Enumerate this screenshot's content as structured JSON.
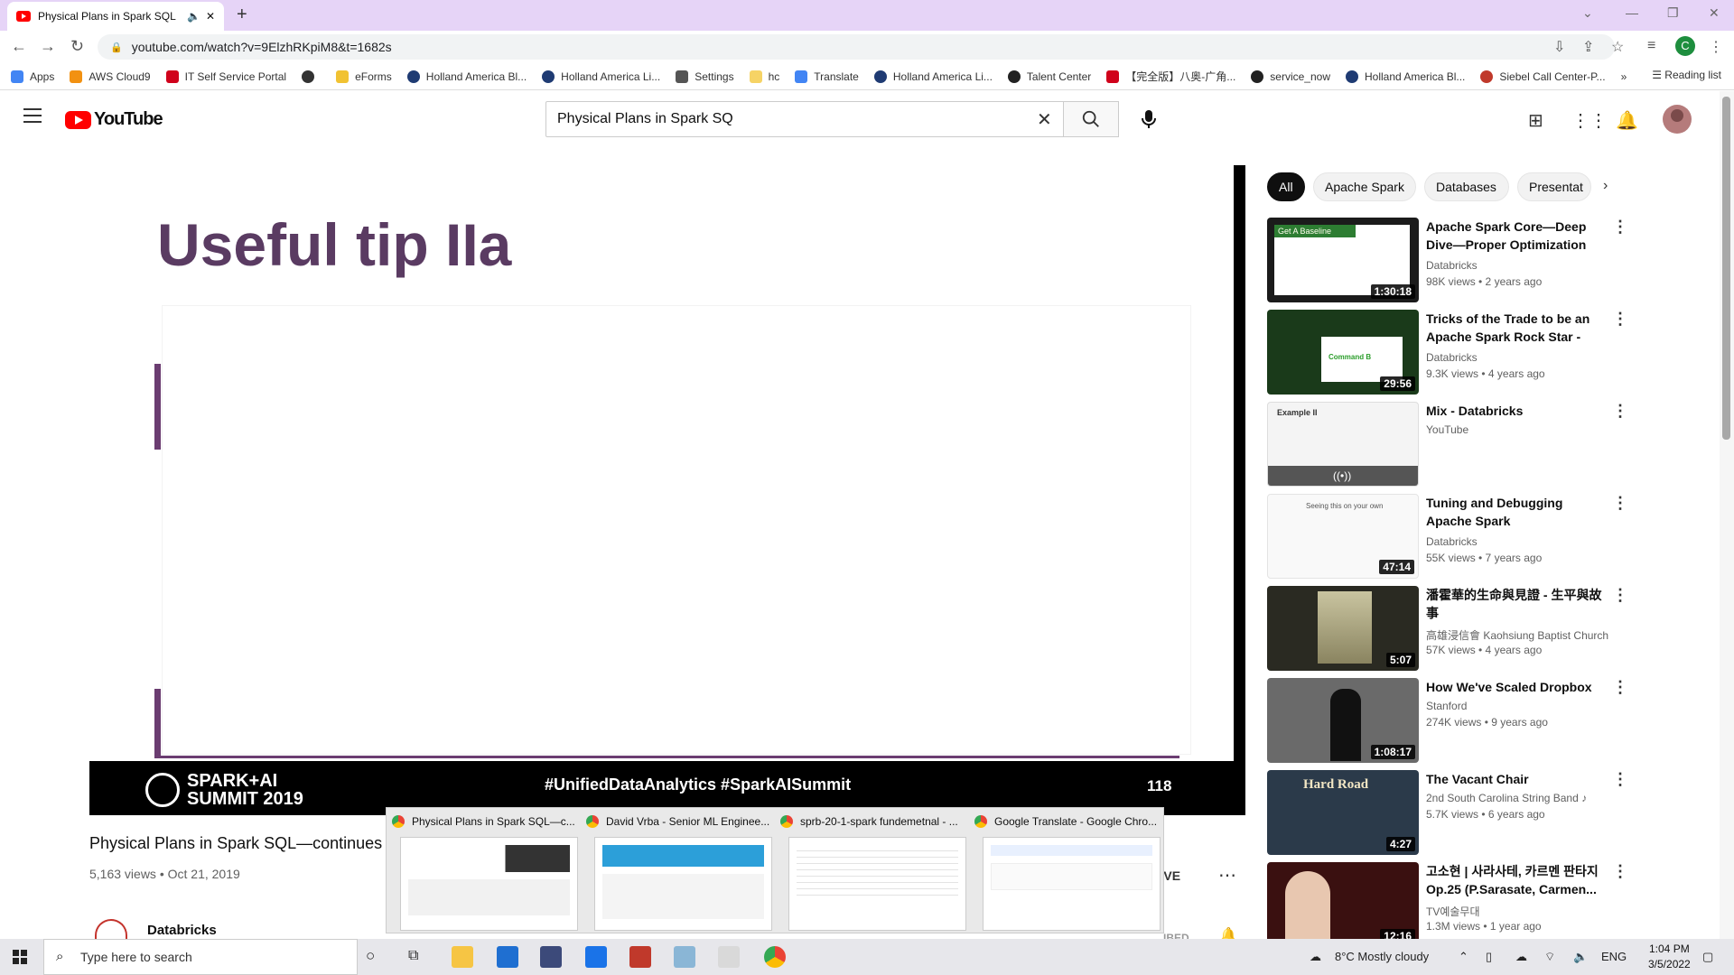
{
  "browser": {
    "tab_title": "Physical Plans in Spark SQL",
    "url": "youtube.com/watch?v=9ElzhRKpiM8&t=1682s",
    "profile_initial": "C",
    "bookmarks": [
      {
        "label": "Apps",
        "color": "#4285f4"
      },
      {
        "label": "AWS Cloud9",
        "color": "#f29111"
      },
      {
        "label": "IT Self Service Portal",
        "color": "#d0021b"
      },
      {
        "label": "",
        "color": "#333333"
      },
      {
        "label": "eForms",
        "color": "#f1c232"
      },
      {
        "label": "Holland America Bl...",
        "color": "#1f3b73"
      },
      {
        "label": "Holland America Li...",
        "color": "#1f3b73"
      },
      {
        "label": "Settings",
        "color": "#555555"
      },
      {
        "label": "hc",
        "color": "#f6d365"
      },
      {
        "label": "Translate",
        "color": "#4285f4"
      },
      {
        "label": "Holland America Li...",
        "color": "#1f3b73"
      },
      {
        "label": "Talent Center",
        "color": "#222222"
      },
      {
        "label": "【完全版】八奥-广角...",
        "color": "#d0021b"
      },
      {
        "label": "service_now",
        "color": "#222222"
      },
      {
        "label": "Holland America Bl...",
        "color": "#1f3b73"
      },
      {
        "label": "Siebel Call Center-P...",
        "color": "#c0392b"
      }
    ],
    "bookmarks_overflow": "»",
    "reading_list": "Reading list"
  },
  "youtube": {
    "logo_text": "YouTube",
    "search_value": "Physical Plans in Spark SQ",
    "player": {
      "slide_title": "Useful tip IIa",
      "footer_logo_line1": "SPARK+AI",
      "footer_logo_line2": "SUMMIT 2019",
      "hashtags": "#UnifiedDataAnalytics #SparkAISummit",
      "slide_number": "118"
    },
    "video": {
      "title": "Physical Plans in Spark SQL—continues -",
      "meta": "5,163 views • Oct 21, 2019",
      "save_label": "SAVE",
      "channel": "Databricks",
      "subscribe_peek": "IBED"
    },
    "chips": [
      "All",
      "Apache Spark",
      "Databases",
      "Presentat"
    ],
    "recommendations": [
      {
        "title": "Apache Spark Core—Deep Dive—Proper Optimization Daniel...",
        "channel": "Databricks",
        "meta": "98K views • 2 years ago",
        "duration": "1:30:18",
        "thumb_color": "#1b1b1b"
      },
      {
        "title": "Tricks of the Trade to be an Apache Spark Rock Star - Ted...",
        "channel": "Databricks",
        "meta": "9.3K views • 4 years ago",
        "duration": "29:56",
        "thumb_color": "#1a3a1a"
      },
      {
        "title": "Mix - Databricks",
        "channel": "YouTube",
        "meta": "",
        "duration": "",
        "thumb_color": "#f4f4f4"
      },
      {
        "title": "Tuning and Debugging Apache Spark",
        "channel": "Databricks",
        "meta": "55K views • 7 years ago",
        "duration": "47:14",
        "thumb_color": "#f9f9f9"
      },
      {
        "title": "潘霍華的生命與見證 - 生平與故事",
        "channel": "高雄浸信會 Kaohsiung Baptist Church",
        "meta": "57K views • 4 years ago",
        "duration": "5:07",
        "thumb_color": "#2a2a22"
      },
      {
        "title": "How We've Scaled Dropbox",
        "channel": "Stanford",
        "meta": "274K views • 9 years ago",
        "duration": "1:08:17",
        "thumb_color": "#6a6a6a"
      },
      {
        "title": "The Vacant Chair",
        "channel": "2nd South Carolina String Band ♪",
        "meta": "5.7K views • 6 years ago",
        "duration": "4:27",
        "thumb_color": "#2b3a4a"
      },
      {
        "title": "고소현 | 사라사테, 카르멘 판타지 Op.25 (P.Sarasate, Carmen...",
        "channel": "TV예술무대",
        "meta": "1.3M views • 1 year ago",
        "duration": "12:16",
        "thumb_color": "#3a1010"
      }
    ],
    "thumb_texts": {
      "baseline": "Get A Baseline",
      "command": "Command B",
      "example": "Example II",
      "seeing": "Seeing this on your own",
      "hardroad": "Hard Road"
    }
  },
  "taskbar_previews": [
    {
      "title": "Physical Plans in Spark SQL—c..."
    },
    {
      "title": "David Vrba - Senior ML Enginee..."
    },
    {
      "title": "sprb-20-1-spark fundemetnal - ..."
    },
    {
      "title": "Google Translate - Google Chro..."
    }
  ],
  "taskbar": {
    "search_placeholder": "Type here to search",
    "weather": "8°C  Mostly cloudy",
    "lang": "ENG",
    "time": "1:04 PM",
    "date": "3/5/2022"
  }
}
